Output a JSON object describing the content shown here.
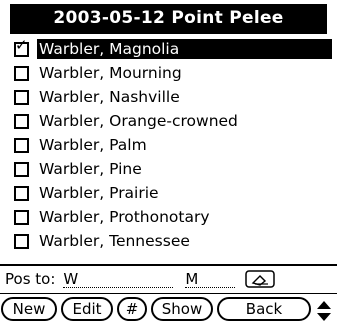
{
  "header": {
    "title": "2003-05-12 Point Pelee"
  },
  "list": {
    "items": [
      {
        "label": "Warbler, Magnolia",
        "checked": true,
        "selected": true
      },
      {
        "label": "Warbler, Mourning",
        "checked": false,
        "selected": false
      },
      {
        "label": "Warbler, Nashville",
        "checked": false,
        "selected": false
      },
      {
        "label": "Warbler, Orange-crowned",
        "checked": false,
        "selected": false
      },
      {
        "label": "Warbler, Palm",
        "checked": false,
        "selected": false
      },
      {
        "label": "Warbler, Pine",
        "checked": false,
        "selected": false
      },
      {
        "label": "Warbler, Prairie",
        "checked": false,
        "selected": false
      },
      {
        "label": "Warbler, Prothonotary",
        "checked": false,
        "selected": false
      },
      {
        "label": "Warbler, Tennessee",
        "checked": false,
        "selected": false
      }
    ]
  },
  "position": {
    "label": "Pos to:",
    "w_value": "W",
    "m_value": "M",
    "eraser_icon": "eraser-icon"
  },
  "buttons": {
    "new": "New",
    "edit": "Edit",
    "hash": "#",
    "show": "Show",
    "back": "Back"
  },
  "scroll": {
    "icon": "scroll-up-down-icon"
  }
}
